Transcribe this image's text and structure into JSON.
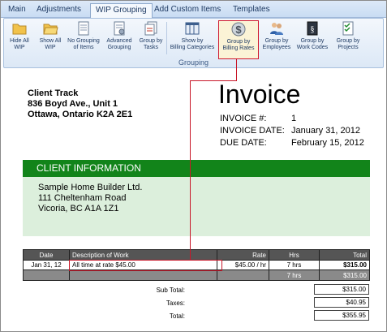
{
  "tabs": [
    {
      "label": "Main",
      "active": false
    },
    {
      "label": "Adjustments",
      "active": false
    },
    {
      "label": "WIP Grouping",
      "active": true
    },
    {
      "label": "Add Custom Items",
      "active": false
    },
    {
      "label": "Templates",
      "active": false
    }
  ],
  "ribbon": {
    "group_label": "Grouping",
    "buttons": [
      {
        "line1": "Hide All",
        "line2": "WIP",
        "icon": "folder-icon"
      },
      {
        "line1": "Show All",
        "line2": "WIP",
        "icon": "folder-open-icon"
      },
      {
        "line1": "No Grouping",
        "line2": "of Items",
        "icon": "document-icon"
      },
      {
        "line1": "Advanced",
        "line2": "Grouping",
        "icon": "document-settings-icon"
      },
      {
        "line1": "Group by",
        "line2": "Tasks",
        "icon": "document-stack-icon"
      },
      {
        "line1": "Show by",
        "line2": "Billing Categories",
        "icon": "columns-icon"
      },
      {
        "line1": "Group by",
        "line2": "Billing Rates",
        "icon": "dollar-icon"
      },
      {
        "line1": "Group by",
        "line2": "Employees",
        "icon": "people-icon"
      },
      {
        "line1": "Group by",
        "line2": "Work Codes",
        "icon": "code-book-icon"
      },
      {
        "line1": "Group by",
        "line2": "Projects",
        "icon": "project-icon"
      }
    ]
  },
  "invoice": {
    "company": {
      "name": "Client Track",
      "address1": "836 Boyd Ave., Unit 1",
      "address2": "Ottawa, Ontario  K2A 2E1"
    },
    "title": "Invoice",
    "number_label": "INVOICE #:",
    "number": "1",
    "date_label": "INVOICE DATE:",
    "date": "January 31, 2012",
    "due_label": "DUE DATE:",
    "due": "February 15, 2012",
    "client_header": "CLIENT INFORMATION",
    "client": {
      "name": "Sample Home Builder Ltd.",
      "address1": "111 Cheltenham Road",
      "address2": "Vicoria, BC  A1A 1Z1"
    },
    "columns": [
      "Date",
      "Description of Work",
      "Rate",
      "Hrs",
      "Total"
    ],
    "row": {
      "date": "Jan 31, 12",
      "desc": "All time at rate $45.00",
      "rate": "$45.00 / hr",
      "hrs": "7 hrs",
      "total": "$315.00"
    },
    "subtotal_row": {
      "hrs": "7 hrs",
      "total": "$315.00"
    },
    "subtotal_label": "Sub Total:",
    "subtotal": "$315.00",
    "taxes_label": "Taxes:",
    "taxes": "$40.95",
    "total_label": "Total:",
    "total": "$355.95"
  },
  "colors": {
    "accent": "#12841a",
    "callout": "#c8182a"
  }
}
